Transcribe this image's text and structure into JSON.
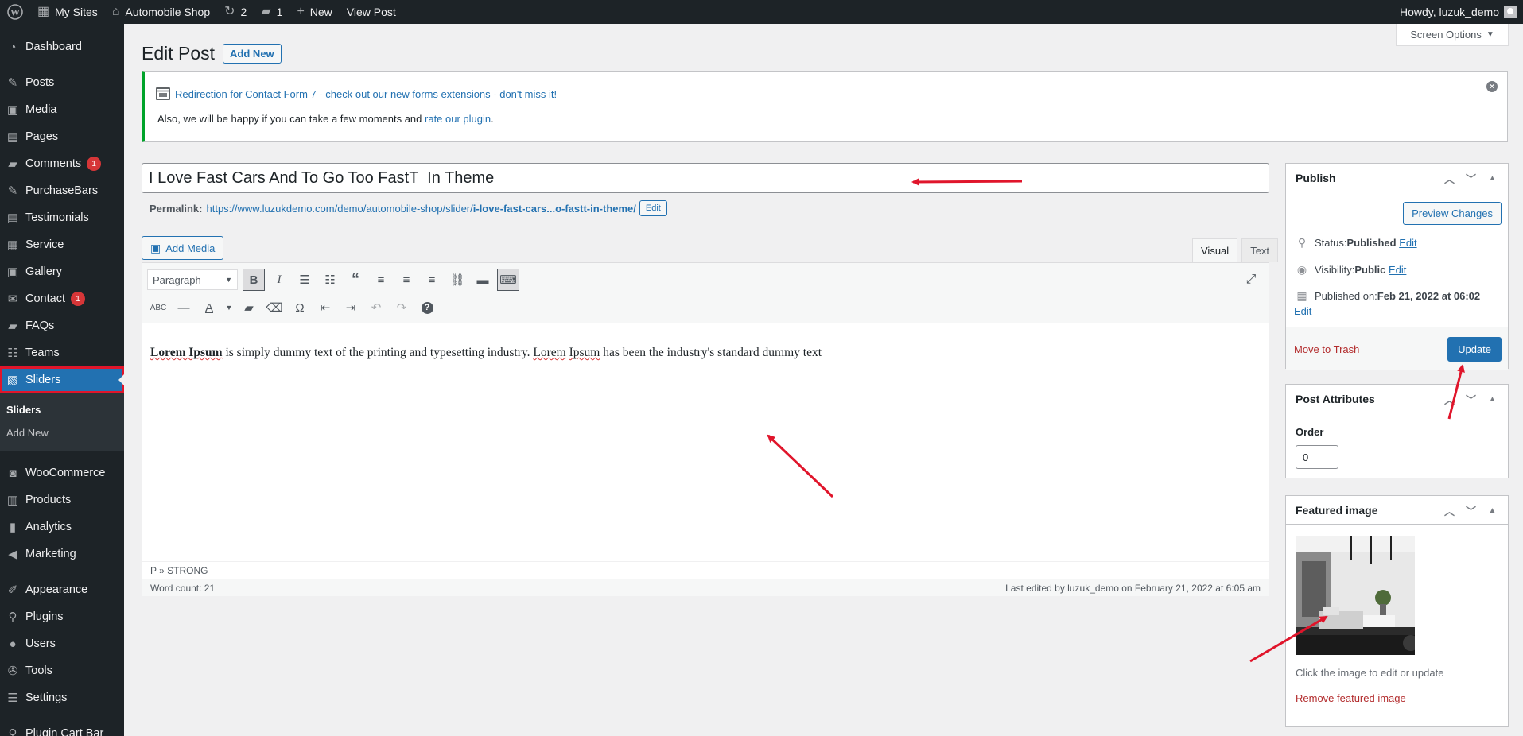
{
  "adminbar": {
    "my_sites": "My Sites",
    "site_name": "Automobile Shop",
    "updates_count": "2",
    "comments_count": "1",
    "new_label": "New",
    "view_post": "View Post",
    "howdy": "Howdy, luzuk_demo"
  },
  "sidebar": {
    "items": [
      {
        "label": "Dashboard",
        "icon": "dashboard-icon"
      },
      {
        "label": "Posts",
        "icon": "pin-icon"
      },
      {
        "label": "Media",
        "icon": "media-icon"
      },
      {
        "label": "Pages",
        "icon": "pages-icon"
      },
      {
        "label": "Comments",
        "icon": "comment-icon",
        "badge": "1"
      },
      {
        "label": "PurchaseBars",
        "icon": "pin-icon"
      },
      {
        "label": "Testimonials",
        "icon": "pages-icon"
      },
      {
        "label": "Service",
        "icon": "grid-icon"
      },
      {
        "label": "Gallery",
        "icon": "media-icon"
      },
      {
        "label": "Contact",
        "icon": "mail-icon",
        "badge": "1"
      },
      {
        "label": "FAQs",
        "icon": "comment-icon"
      },
      {
        "label": "Teams",
        "icon": "teams-icon"
      },
      {
        "label": "Sliders",
        "icon": "sliders-icon"
      },
      {
        "label": "WooCommerce",
        "icon": "woo-icon"
      },
      {
        "label": "Products",
        "icon": "products-icon"
      },
      {
        "label": "Analytics",
        "icon": "analytics-icon"
      },
      {
        "label": "Marketing",
        "icon": "megaphone-icon"
      },
      {
        "label": "Appearance",
        "icon": "brush-icon"
      },
      {
        "label": "Plugins",
        "icon": "plugin-icon"
      },
      {
        "label": "Users",
        "icon": "users-icon"
      },
      {
        "label": "Tools",
        "icon": "wrench-icon"
      },
      {
        "label": "Settings",
        "icon": "settings-icon"
      },
      {
        "label": "Plugin Cart Bar",
        "icon": "plugin-icon"
      }
    ],
    "submenu": [
      "Sliders",
      "Add New"
    ]
  },
  "header": {
    "screen_options": "Screen Options",
    "title": "Edit Post",
    "add_new": "Add New"
  },
  "notice": {
    "link_text": "Redirection for Contact Form 7 - check out our new forms extensions - don't miss it!",
    "line2_prefix": "Also, we will be happy if you can take a few moments and ",
    "line2_link": "rate our plugin",
    "line2_suffix": "."
  },
  "post": {
    "title": "I Love Fast Cars And To Go Too FastT  In Theme",
    "permalink_label": "Permalink:",
    "permalink_base": "https://www.luzukdemo.com/demo/automobile-shop/slider/",
    "permalink_slug": "i-love-fast-cars...o-fastt-in-theme/",
    "permalink_edit": "Edit"
  },
  "editor": {
    "add_media": "Add Media",
    "tab_visual": "Visual",
    "tab_text": "Text",
    "format_select": "Paragraph",
    "content_bold": "Lorem Ipsum",
    "content_rest_1": " is simply dummy text of the printing and typesetting industry. ",
    "content_spell_1": "Lorem",
    "content_space": " ",
    "content_spell_2": "Ipsum",
    "content_rest_2": " has been the industry's standard dummy text",
    "path": "P » STRONG",
    "word_count": "Word count: 21",
    "last_edited": "Last edited by luzuk_demo on February 21, 2022 at 6:05 am"
  },
  "publish": {
    "title": "Publish",
    "preview": "Preview Changes",
    "status_label": "Status: ",
    "status_value": "Published",
    "visibility_label": "Visibility: ",
    "visibility_value": "Public",
    "published_label": "Published on: ",
    "published_value": "Feb 21, 2022 at 06:02",
    "edit": "Edit",
    "move_to_trash": "Move to Trash",
    "update": "Update"
  },
  "attributes": {
    "title": "Post Attributes",
    "order_label": "Order",
    "order_value": "0"
  },
  "featured": {
    "title": "Featured image",
    "hint": "Click the image to edit or update",
    "remove": "Remove featured image"
  },
  "colors": {
    "adminbar_bg": "#1d2327",
    "accent": "#2271b1",
    "badge": "#d63638",
    "annotation_arrow": "#e0152b",
    "notice_border": "#00a32a"
  }
}
